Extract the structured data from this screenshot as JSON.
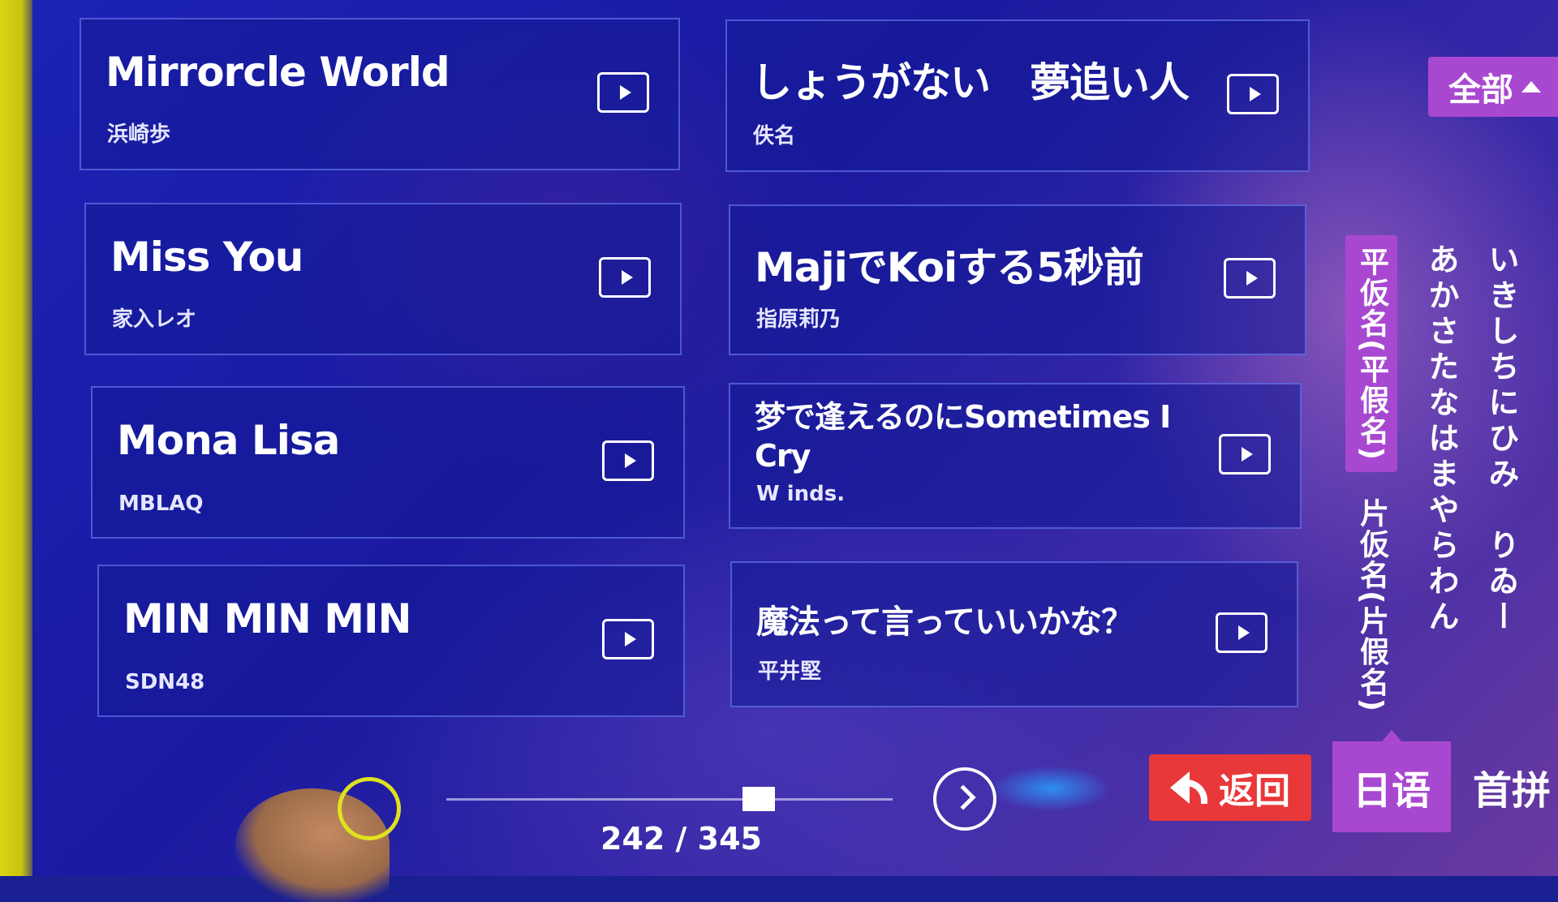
{
  "songs": [
    {
      "title": "Mirrorcle World",
      "artist": "浜崎歩"
    },
    {
      "title": "しょうがない　夢追い人",
      "artist": "佚名"
    },
    {
      "title": "Miss You",
      "artist": "家入レオ"
    },
    {
      "title": "MajiでKoiする5秒前",
      "artist": "指原莉乃"
    },
    {
      "title": "Mona Lisa",
      "artist": "MBLAQ"
    },
    {
      "title": "梦で逢えるのにSometimes I Cry",
      "artist": "W inds."
    },
    {
      "title": "MIN MIN MIN",
      "artist": "SDN48"
    },
    {
      "title": "魔法って言っていいかな？",
      "artist": "平井堅"
    }
  ],
  "filter": {
    "label": "全部"
  },
  "kana_tabs": {
    "hiragana": "平仮名(平假名)",
    "katakana": "片仮名(片假名)"
  },
  "kana_columns": [
    "あかさたなはまやらわん",
    "いきしちにひみ　りゐー"
  ],
  "pagination": {
    "current": 242,
    "total": 345,
    "label": "242 / 345",
    "progress": 0.7
  },
  "buttons": {
    "back": "返回"
  },
  "lang_tabs": [
    "日语",
    "首拼"
  ],
  "colors": {
    "accent": "#a848d0",
    "back": "#e8383a",
    "bg": "#1a1f92"
  }
}
